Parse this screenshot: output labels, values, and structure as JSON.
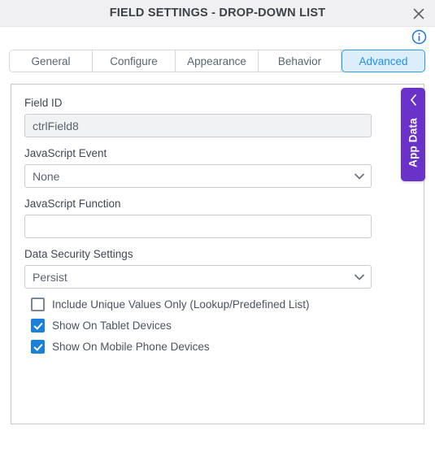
{
  "dialog": {
    "title": "FIELD SETTINGS - DROP-DOWN LIST",
    "close_icon": "close-icon",
    "info_icon": "info-circle-icon"
  },
  "tabs": [
    {
      "label": "General",
      "active": false
    },
    {
      "label": "Configure",
      "active": false
    },
    {
      "label": "Appearance",
      "active": false
    },
    {
      "label": "Behavior",
      "active": false
    },
    {
      "label": "Advanced",
      "active": true
    }
  ],
  "form": {
    "field_id": {
      "label": "Field ID",
      "value": "ctrlField8",
      "placeholder": ""
    },
    "javascript_event": {
      "label": "JavaScript Event",
      "value": "None",
      "options": [
        "None"
      ]
    },
    "javascript_function": {
      "label": "JavaScript Function",
      "value": "",
      "placeholder": ""
    },
    "data_security_settings": {
      "label": "Data Security Settings",
      "value": "Persist",
      "options": [
        "Persist"
      ]
    },
    "checkboxes": [
      {
        "label": "Include Unique Values Only (Lookup/Predefined List)",
        "checked": false
      },
      {
        "label": "Show On Tablet Devices",
        "checked": true
      },
      {
        "label": "Show On Mobile Phone Devices",
        "checked": true
      }
    ]
  },
  "side_panel": {
    "label": "App Data",
    "chevron_icon": "chevron-left-icon"
  },
  "colors": {
    "accent_blue": "#2a9ceb",
    "active_tab_bg": "#ddeefb",
    "checkbox_blue": "#1a80d9",
    "app_data_purple": "#6a32c9",
    "titlebar_bg": "#f0f0f2",
    "panel_border": "#c3c7ce"
  }
}
